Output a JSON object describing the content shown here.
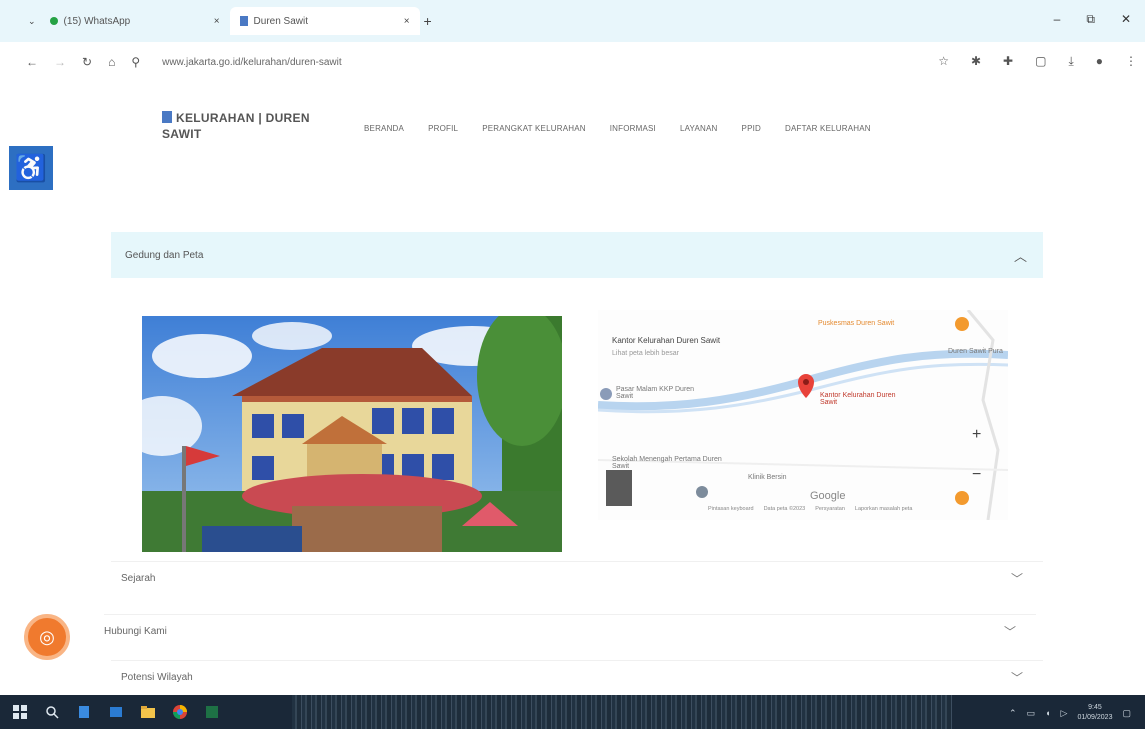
{
  "browser": {
    "tabs": [
      {
        "label": "(15) WhatsApp",
        "close": "×"
      },
      {
        "label": "Duren Sawit",
        "close": "×"
      }
    ],
    "new_tab": "+",
    "tab_list": "⌄",
    "url": "www.jakarta.go.id/kelurahan/duren-sawit",
    "window_controls": {
      "minimize": "–",
      "maximize": "⧉",
      "close": "✕"
    }
  },
  "site": {
    "logo_text": "KELURAHAN | DUREN SAWIT",
    "nav": [
      "BERANDA",
      "PROFIL",
      "PERANGKAT KELURAHAN",
      "INFORMASI",
      "LAYANAN",
      "PPID",
      "DAFTAR KELURAHAN"
    ]
  },
  "accordion": {
    "open_title": "Gedung dan Peta",
    "rows": [
      "Sejarah",
      "Hubungi Kami",
      "Potensi Wilayah"
    ]
  },
  "map": {
    "place_title": "Kantor Kelurahan Duren Sawit",
    "place_sub": "Lihat peta lebih besar",
    "labels": {
      "poi_1": "Puskesmas Duren Sawit",
      "poi_2": "Pasar Malam KKP Duren Sawit",
      "marker_label": "Kantor Kelurahan Duren Sawit",
      "poi_3": "Sekolah Menengah Pertama Duren Sawit",
      "poi_4": "Duren Sawit Pura",
      "poi_5": "Klinik Bersin"
    },
    "google": "Google",
    "footer": [
      "Pintasan keyboard",
      "Data peta ©2023",
      "Persyaratan",
      "Laporkan masalah peta"
    ]
  },
  "colors": {
    "accent": "#2d6fc2",
    "accordion_bg": "#e6f7fb",
    "float_button": "#f07a2e",
    "map_marker": "#e8423a",
    "taskbar": "#1a2838"
  },
  "taskbar": {
    "clock_time": "9:45",
    "clock_date": "01/09/2023"
  }
}
